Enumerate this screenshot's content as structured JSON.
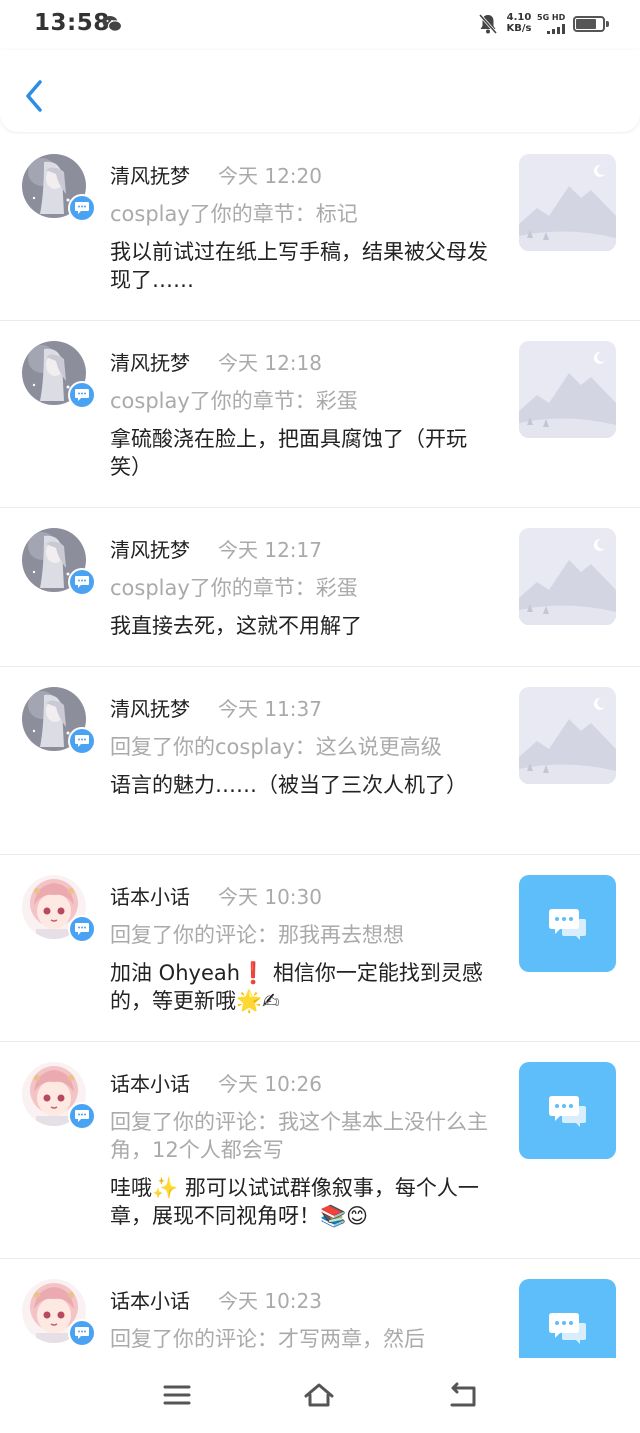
{
  "status_bar": {
    "time": "13:58",
    "net_speed_value": "4.10",
    "net_speed_unit": "KB/s",
    "net_type": "5G HD",
    "battery_level": 0.75,
    "icons": [
      "wechat-icon",
      "mute-bell-icon",
      "signal-icon",
      "battery-icon"
    ]
  },
  "header": {
    "back_icon": "chevron-left-icon",
    "accent_color": "#2a8ee6"
  },
  "messages": [
    {
      "user": "清风抚梦",
      "time": "今天 12:20",
      "action": "cosplay了你的章节：标记",
      "content": "我以前试过在纸上写手稿，结果被父母发现了……",
      "thumb": "image-placeholder"
    },
    {
      "user": "清风抚梦",
      "time": "今天 12:18",
      "action": "cosplay了你的章节：彩蛋",
      "content": "拿硫酸浇在脸上，把面具腐蚀了（开玩笑）",
      "thumb": "image-placeholder"
    },
    {
      "user": "清风抚梦",
      "time": "今天 12:17",
      "action": "cosplay了你的章节：彩蛋",
      "content": "我直接去死，这就不用解了",
      "thumb": "image-placeholder"
    },
    {
      "user": "清风抚梦",
      "time": "今天 11:37",
      "action": "回复了你的cosplay：这么说更高级",
      "content": "语言的魅力……（被当了三次人机了）",
      "thumb": "image-placeholder"
    },
    {
      "user": "话本小话",
      "time": "今天 10:30",
      "action": "回复了你的评论：那我再去想想",
      "content": "加油 Ohyeah❗ 相信你一定能找到灵感的，等更新哦🌟✍",
      "thumb": "comment-icon"
    },
    {
      "user": "话本小话",
      "time": "今天 10:26",
      "action": "回复了你的评论：我这个基本上没什么主角，12个人都会写",
      "content": "哇哦✨ 那可以试试群像叙事，每个人一章，展现不同视角呀！📚😊",
      "thumb": "comment-icon"
    },
    {
      "user": "话本小话",
      "time": "今天 10:23",
      "action": "回复了你的评论：才写两章，然后",
      "content": "",
      "thumb": "comment-icon"
    }
  ],
  "colors": {
    "badge": "#4aa3f2",
    "comment_tile": "#5ebef9",
    "secondary_text": "#aaaaaa"
  },
  "nav_bar": {
    "icons": [
      "menu-icon",
      "home-icon",
      "back-return-icon"
    ]
  }
}
